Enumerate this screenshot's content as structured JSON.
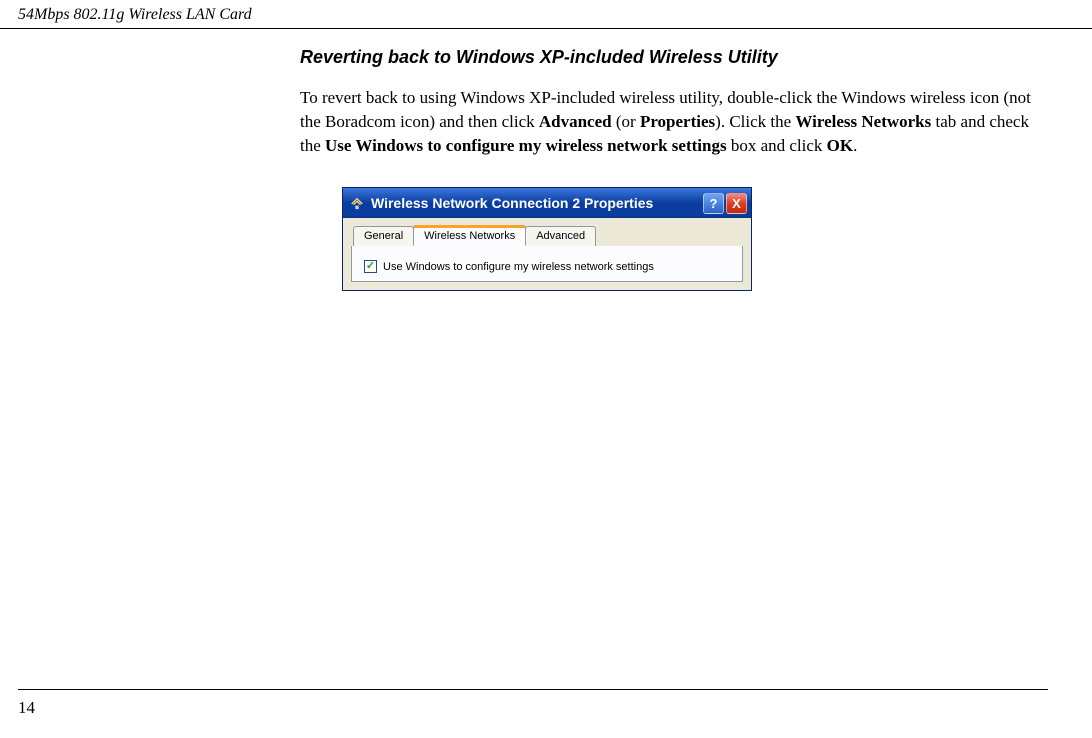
{
  "header": {
    "title": "54Mbps 802.11g Wireless LAN Card"
  },
  "section": {
    "title": "Reverting back to Windows XP-included Wireless Utility",
    "para_parts": {
      "t1": "To revert back to using Windows XP-included wireless utility, double-click the Windows wireless icon (not the Boradcom icon) and then click ",
      "b1": "Advanced",
      "t2": " (or ",
      "b2": "Properties",
      "t3": "). Click the ",
      "b3": "Wireless Networks",
      "t4": " tab and check the ",
      "b4": "Use Windows to configure my wireless network settings",
      "t5": " box and click ",
      "b5": "OK",
      "t6": "."
    }
  },
  "dialog": {
    "titlebar": "Wireless Network Connection 2 Properties",
    "help_symbol": "?",
    "close_symbol": "X",
    "tabs": {
      "general": "General",
      "wireless": "Wireless Networks",
      "advanced": "Advanced"
    },
    "checkbox_label": "Use Windows to configure my wireless network settings"
  },
  "page_number": "14"
}
